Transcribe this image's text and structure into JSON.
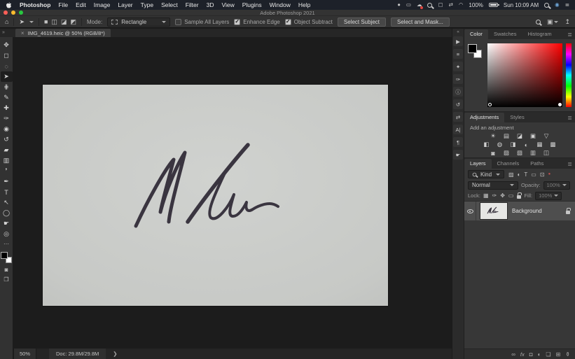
{
  "menu_bar": {
    "items": [
      "Photoshop",
      "File",
      "Edit",
      "Image",
      "Layer",
      "Type",
      "Select",
      "Filter",
      "3D",
      "View",
      "Plugins",
      "Window",
      "Help"
    ],
    "status_icons": [
      {
        "name": "status-dot-icon",
        "glyph": "●"
      },
      {
        "name": "screen-mirroring-icon",
        "glyph": "▭"
      },
      {
        "name": "creative-cloud-icon",
        "glyph": "☁"
      },
      {
        "name": "display-icon",
        "glyph": "▢"
      },
      {
        "name": "universal-control-icon",
        "glyph": "⇄"
      },
      {
        "name": "wifi-icon",
        "glyph": "◠"
      }
    ],
    "status": {
      "battery_percent": "100%",
      "clock": "Sun 10:09 AM"
    },
    "right_icons": [
      {
        "name": "siri-icon",
        "glyph": "◉"
      },
      {
        "name": "control-center-icon",
        "glyph": "≣"
      }
    ]
  },
  "window": {
    "title": "Adobe Photoshop 2021"
  },
  "options_bar": {
    "home_glyph": "⌂",
    "tool_glyph": "➤",
    "selection_modes": [
      {
        "name": "new-selection",
        "glyph": "■"
      },
      {
        "name": "add-to-selection",
        "glyph": "◫"
      },
      {
        "name": "subtract-from-selection",
        "glyph": "◪"
      },
      {
        "name": "intersect-selection",
        "glyph": "◩"
      }
    ],
    "mode_label": "Mode:",
    "mode_value": "Rectangle",
    "sample_all_layers": {
      "label": "Sample All Layers",
      "checked": false
    },
    "enhance_edge": {
      "label": "Enhance Edge",
      "checked": true
    },
    "object_subtract": {
      "label": "Object Subtract",
      "checked": true
    },
    "select_subject": "Select Subject",
    "select_and_mask": "Select and Mask...",
    "workspace_glyph": "▣",
    "share_glyph": "↥"
  },
  "document_tab": {
    "title": "IMG_4619.heic @ 50% (RGB/8*)",
    "close_glyph": "×"
  },
  "chrome": {
    "toolbar_expand_glyph": "»",
    "dock_expand_glyph": "«"
  },
  "tools": [
    {
      "name": "move-tool",
      "glyph": "✥"
    },
    {
      "name": "rectangular-marquee-tool",
      "glyph": "◻"
    },
    {
      "name": "lasso-tool",
      "glyph": "◌"
    },
    {
      "name": "object-selection-tool",
      "glyph": "➤",
      "selected": true
    },
    {
      "name": "crop-tool",
      "glyph": "⋕"
    },
    {
      "name": "eyedropper-tool",
      "glyph": "✎"
    },
    {
      "name": "spot-healing-brush-tool",
      "glyph": "✚"
    },
    {
      "name": "brush-tool",
      "glyph": "✑"
    },
    {
      "name": "clone-stamp-tool",
      "glyph": "◉"
    },
    {
      "name": "history-brush-tool",
      "glyph": "↺"
    },
    {
      "name": "eraser-tool",
      "glyph": "▰"
    },
    {
      "name": "gradient-tool",
      "glyph": "▥"
    },
    {
      "name": "blur-tool",
      "glyph": "❜"
    },
    {
      "name": "pen-tool",
      "glyph": "✒"
    },
    {
      "name": "type-tool",
      "glyph": "T"
    },
    {
      "name": "path-selection-tool",
      "glyph": "↖"
    },
    {
      "name": "ellipse-tool",
      "glyph": "◯"
    },
    {
      "name": "hand-tool",
      "glyph": "☛"
    },
    {
      "name": "zoom-tool",
      "glyph": "◎"
    }
  ],
  "toolbar_extras": {
    "more_glyph": "⋯",
    "foreground_color": "#000000",
    "background_color": "#ffffff",
    "quick_mask_glyph": "◙",
    "screen_mode_glyph": "❐"
  },
  "collapsed_panels": [
    {
      "name": "actions-panel-icon",
      "glyph": "▶"
    },
    {
      "name": "adjustments-sliders-panel-icon",
      "glyph": "≡"
    },
    {
      "name": "styles-panel-icon",
      "glyph": "✦"
    },
    {
      "name": "brush-settings-panel-icon",
      "glyph": "✑"
    },
    {
      "name": "info-panel-icon",
      "glyph": "ⓘ"
    },
    {
      "name": "history-panel-icon",
      "glyph": "↺"
    },
    {
      "name": "properties-panel-icon",
      "glyph": "⇄"
    },
    {
      "name": "character-panel-icon",
      "glyph": "A|"
    },
    {
      "name": "paragraph-panel-icon",
      "glyph": "¶"
    },
    {
      "name": "learn-panel-icon",
      "glyph": "☛"
    }
  ],
  "panels": {
    "color": {
      "tabs": [
        "Color",
        "Swatches",
        "Histogram"
      ],
      "active_tab": "Color",
      "menu_glyph": "≣",
      "foreground_color": "#000000",
      "background_color": "#ffffff",
      "hue": "red"
    },
    "adjustments": {
      "tabs": [
        "Adjustments",
        "Styles"
      ],
      "active_tab": "Adjustments",
      "menu_glyph": "≣",
      "hint": "Add an adjustment",
      "icons": [
        {
          "name": "brightness-contrast",
          "glyph": "☀"
        },
        {
          "name": "levels",
          "glyph": "▤"
        },
        {
          "name": "curves",
          "glyph": "◪"
        },
        {
          "name": "exposure",
          "glyph": "▣"
        },
        {
          "name": "vibrance",
          "glyph": "▽"
        },
        {
          "name": "hue-saturation",
          "glyph": "◧"
        },
        {
          "name": "color-balance",
          "glyph": "◍"
        },
        {
          "name": "black-white",
          "glyph": "◨"
        },
        {
          "name": "photo-filter",
          "glyph": "◐"
        },
        {
          "name": "channel-mixer",
          "glyph": "▦"
        },
        {
          "name": "color-lookup",
          "glyph": "▩"
        },
        {
          "name": "invert",
          "glyph": "◙"
        },
        {
          "name": "posterize",
          "glyph": "▨"
        },
        {
          "name": "threshold",
          "glyph": "▧"
        },
        {
          "name": "gradient-map",
          "glyph": "▥"
        },
        {
          "name": "selective-color",
          "glyph": "◫"
        }
      ]
    },
    "layers": {
      "tabs": [
        "Layers",
        "Channels",
        "Paths"
      ],
      "active_tab": "Layers",
      "menu_glyph": "≣",
      "filter": {
        "kind_label": "Kind",
        "icons": [
          {
            "name": "filter-pixel-layers",
            "glyph": "▨"
          },
          {
            "name": "filter-adjustment-layers",
            "glyph": "◐"
          },
          {
            "name": "filter-type-layers",
            "glyph": "T"
          },
          {
            "name": "filter-shape-layers",
            "glyph": "▭"
          },
          {
            "name": "filter-smart-objects",
            "glyph": "⊡"
          },
          {
            "name": "filter-toggle",
            "glyph": "●"
          }
        ]
      },
      "blend_mode": "Normal",
      "opacity_label": "Opacity:",
      "opacity_value": "100%",
      "lock_label": "Lock:",
      "lock_icons": [
        {
          "name": "lock-transparent-pixels",
          "glyph": "▦"
        },
        {
          "name": "lock-image-pixels",
          "glyph": "✑"
        },
        {
          "name": "lock-position",
          "glyph": "✥"
        },
        {
          "name": "lock-artboard",
          "glyph": "▭"
        }
      ],
      "fill_label": "Fill:",
      "fill_value": "100%",
      "layers": [
        {
          "name": "Background",
          "visible": true,
          "locked": true,
          "selected": true
        }
      ],
      "footer_icons": [
        {
          "name": "link-layers",
          "glyph": "∞"
        },
        {
          "name": "layer-effects",
          "glyph": "fx"
        },
        {
          "name": "add-layer-mask",
          "glyph": "◘"
        },
        {
          "name": "new-adjustment-layer",
          "glyph": "◐"
        },
        {
          "name": "new-group",
          "glyph": "❏"
        },
        {
          "name": "new-layer",
          "glyph": "⊞"
        },
        {
          "name": "delete-layer",
          "glyph": "⚱"
        }
      ]
    }
  },
  "status_bar": {
    "zoom": "50%",
    "doc_info": "Doc: 29.8M/29.8M",
    "chevron": "❯"
  },
  "canvas": {
    "content": "handwritten signature in black marker on gray-white paper",
    "paper_color": "#c7c9c6",
    "ink_color": "#3a3540"
  }
}
